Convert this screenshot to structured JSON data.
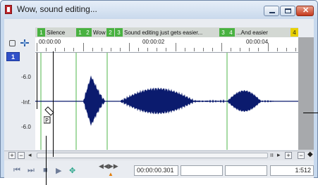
{
  "window": {
    "title": "Wow, sound editing..."
  },
  "markers": [
    {
      "num": "1",
      "label": "Silence"
    },
    {
      "num": "1",
      "label": ""
    },
    {
      "num": "2",
      "label": "Wow"
    },
    {
      "num": "2",
      "label": ""
    },
    {
      "num": "3",
      "label": "Sound editing just gets easier..."
    },
    {
      "num": "3",
      "label": ""
    },
    {
      "num": "4",
      "label": "...And easier"
    },
    {
      "num": "4",
      "label": ""
    }
  ],
  "ruler": {
    "ticks": [
      "00:00:00",
      "00:00:02",
      "00:00:04"
    ]
  },
  "track": {
    "number": "1",
    "db_labels": [
      "-6.0",
      "-Inf.",
      "-6.0"
    ]
  },
  "transport": {
    "time": "00:00:00.301",
    "zoom": "1:512"
  },
  "colors": {
    "waveform": "#0b1b6e",
    "marker_line": "#4fb64a",
    "marker_flag": "#49b241",
    "end_marker": "#e8d000",
    "center_line": "#3a4fc2"
  }
}
